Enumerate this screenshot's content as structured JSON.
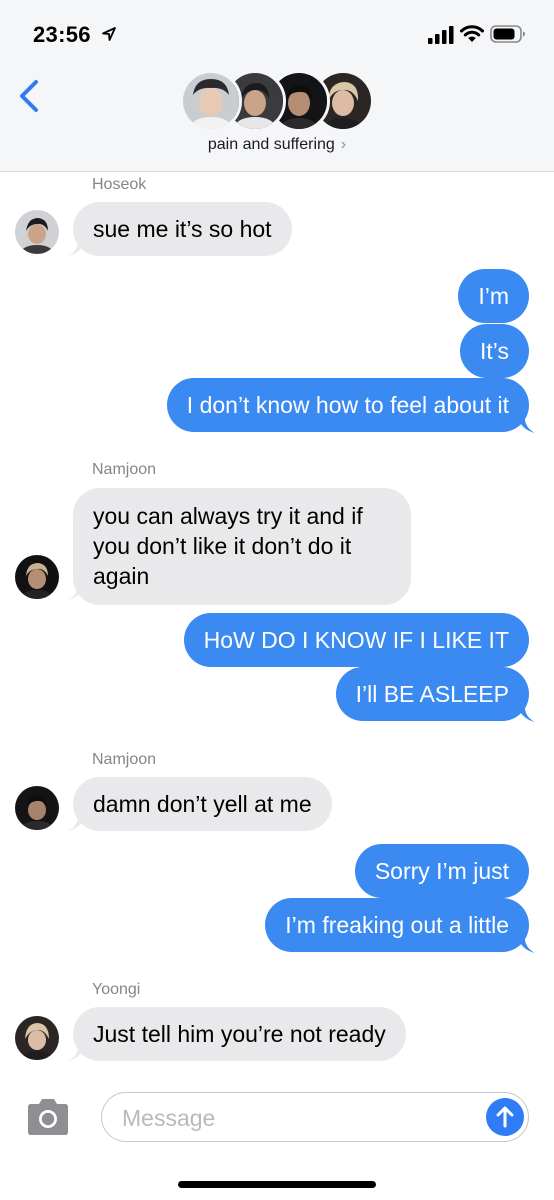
{
  "status_bar": {
    "time": "23:56",
    "icons": [
      "location-arrow-icon",
      "cellular-signal-icon",
      "wifi-icon",
      "battery-icon"
    ]
  },
  "header": {
    "back_icon": "chevron-left-icon",
    "group_name": "pain and suffering",
    "name_chevron": "›",
    "avatar_count": 4
  },
  "messages": [
    {
      "sender": "Hoseok",
      "direction": "incoming",
      "text": "sue me it’s so hot"
    },
    {
      "direction": "outgoing",
      "text": "I’m"
    },
    {
      "direction": "outgoing",
      "text": "It’s"
    },
    {
      "direction": "outgoing",
      "text": "I don’t know how to feel about it"
    },
    {
      "sender": "Namjoon",
      "direction": "incoming",
      "text": "you can always try it and if you don’t like it don’t do it again"
    },
    {
      "direction": "outgoing",
      "text": "HoW DO I KNOW IF I LIKE IT"
    },
    {
      "direction": "outgoing",
      "text": "I’ll BE ASLEEP"
    },
    {
      "sender": "Namjoon",
      "direction": "incoming",
      "text": "damn don’t yell at me"
    },
    {
      "direction": "outgoing",
      "text": "Sorry I’m just"
    },
    {
      "direction": "outgoing",
      "text": "I’m freaking out a little"
    },
    {
      "sender": "Yoongi",
      "direction": "incoming",
      "text": "Just tell him you’re not ready"
    }
  ],
  "composer": {
    "camera_icon": "camera-icon",
    "placeholder": "Message",
    "send_icon": "arrow-up-icon"
  },
  "colors": {
    "outgoing_bubble": "#3a8af2",
    "incoming_bubble": "#e9e9eb",
    "accent": "#2f7cf6"
  }
}
